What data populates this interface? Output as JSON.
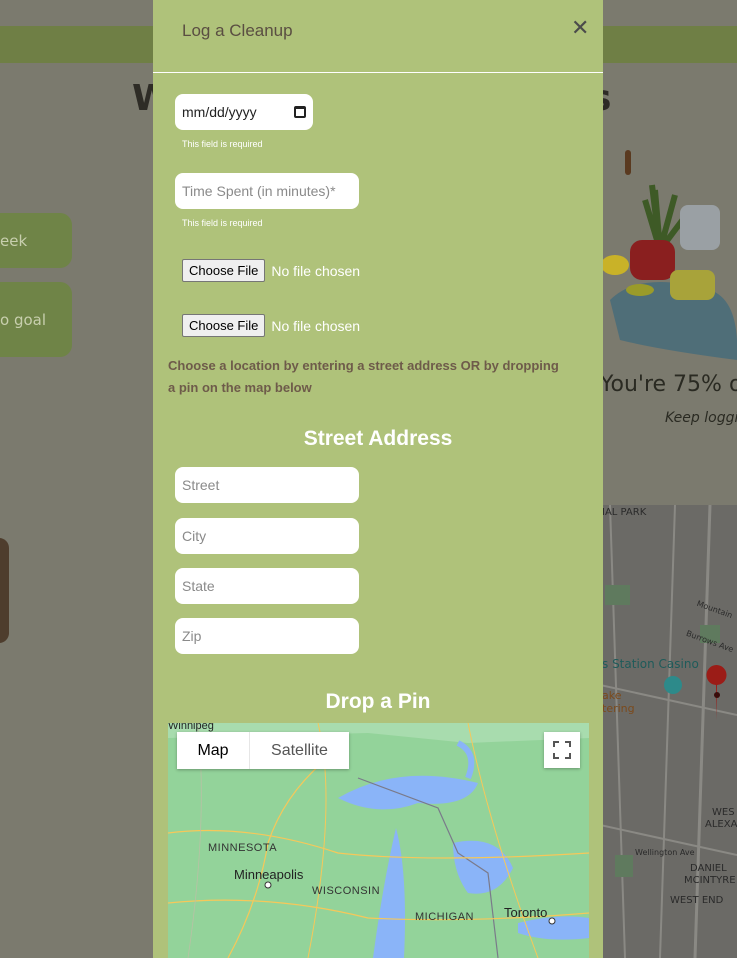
{
  "background": {
    "heading_left": "W",
    "heading_right": "s",
    "week_button": "eek",
    "goal_button": "o goal",
    "progress_text": "You're 75% o",
    "keep_text": "Keep loggin",
    "map_labels": [
      "IAL PARK",
      "s Station Casino",
      "ake",
      "tering",
      "WES",
      "ALEXA",
      "DANIEL",
      "MCINTYRE",
      "WEST END",
      "Wellington Ave",
      "Burrows Ave",
      "Mountain"
    ]
  },
  "modal": {
    "title": "Log a Cleanup",
    "close_glyph": "✕",
    "date_placeholder": "mm/dd/yyyy",
    "date_required": "This field is required",
    "time_placeholder": "Time Spent (in minutes)*",
    "time_required": "This field is required",
    "file1_button": "Choose File",
    "file1_status": "No file chosen",
    "file2_button": "Choose File",
    "file2_status": "No file chosen",
    "instructions": "Choose a location by entering a street address OR by dropping a pin on the map below",
    "street_address_title": "Street Address",
    "street_placeholder": "Street",
    "city_placeholder": "City",
    "state_placeholder": "State",
    "zip_placeholder": "Zip",
    "drop_pin_title": "Drop a Pin",
    "map": {
      "map_option": "Map",
      "satellite_option": "Satellite",
      "labels": {
        "winnipeg": "Winnipeg",
        "minnesota": "MINNESOTA",
        "minneapolis": "Minneapolis",
        "wisconsin": "WISCONSIN",
        "michigan": "MICHIGAN",
        "toronto": "Toronto"
      }
    }
  },
  "colors": {
    "modal_bg": "#afc27a",
    "overlay": "#7b7a6e",
    "header_text": "#5a4e42",
    "map_land": "#93d39a",
    "map_water": "#8ab4f8"
  }
}
